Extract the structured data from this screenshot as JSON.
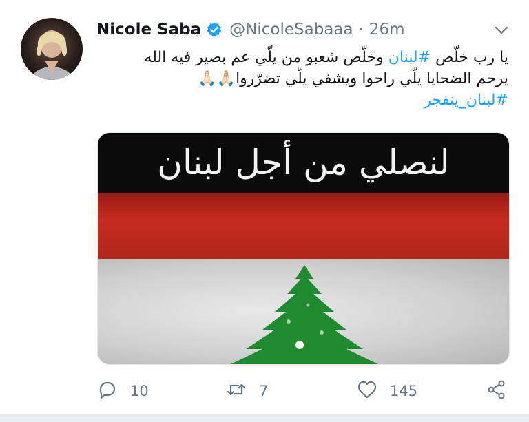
{
  "tweet": {
    "author_name": "Nicole Saba",
    "handle": "@NicoleSabaaa",
    "separator": "·",
    "time": "26m",
    "text_line1_a": "يا رب خلّص ",
    "text_line1_tag": "#لبنان",
    "text_line1_b": " وخلّص شعبو من يلّي عم بصير فيه الله",
    "text_line2": "يرحم الضحايا يلّي راحوا ويشفي يلّي تضرّروا🙏🏻🙏🏻",
    "text_line3_tag": "#لبنان_ينفجر",
    "image_caption": "لنصلي من أجل لبنان"
  },
  "actions": {
    "reply_count": "10",
    "retweet_count": "7",
    "like_count": "145"
  },
  "colors": {
    "link": "#1da1f2",
    "muted": "#657786"
  },
  "icons": [
    "verified-badge-icon",
    "chevron-down-icon",
    "reply-icon",
    "retweet-icon",
    "like-icon",
    "share-icon"
  ]
}
